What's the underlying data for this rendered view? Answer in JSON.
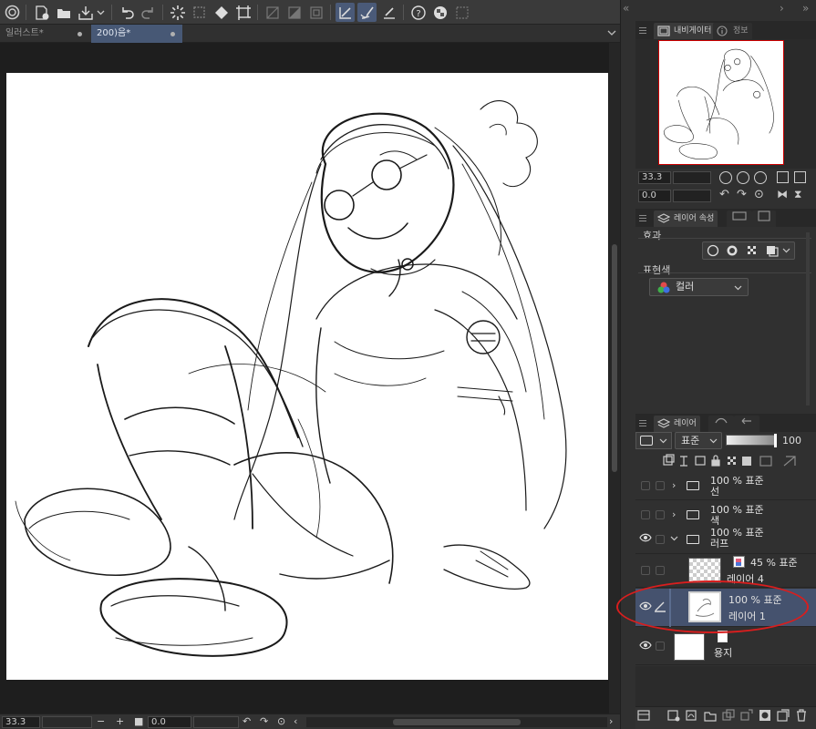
{
  "tabs": [
    {
      "label": "일러스트*"
    },
    {
      "label": "200)음*"
    }
  ],
  "status": {
    "zoom": "33.3",
    "rotation": "0.0"
  },
  "navigator": {
    "tab_label": "내비게이터",
    "info_label": "정보",
    "zoom": "33.3",
    "rotation": "0.0"
  },
  "layer_property": {
    "tab_label": "레이어 속성",
    "effect_label": "효과",
    "expression_color_label": "표현색",
    "expression_color_value": "컬러"
  },
  "layers_panel": {
    "tab_label": "레이어",
    "blend_mode": "표준",
    "opacity": "100"
  },
  "layers": [
    {
      "name": "선",
      "mode": "100 % 표준",
      "type": "folder",
      "visible": false
    },
    {
      "name": "색",
      "mode": "100 % 표준",
      "type": "folder",
      "visible": false
    },
    {
      "name": "러프",
      "mode": "100 % 표준",
      "type": "folder-open",
      "visible": true
    },
    {
      "name": "레이어 4",
      "mode": "45 % 표준",
      "type": "raster",
      "visible": false
    },
    {
      "name": "레이어 1",
      "mode": "100 % 표준",
      "type": "raster",
      "visible": true,
      "selected": true
    },
    {
      "name": "용지",
      "mode": "",
      "type": "paper",
      "visible": true
    }
  ],
  "colors": {
    "selected_layer": "#45526e",
    "annotation_ring": "#d81e1e",
    "active_tab": "#475875"
  }
}
